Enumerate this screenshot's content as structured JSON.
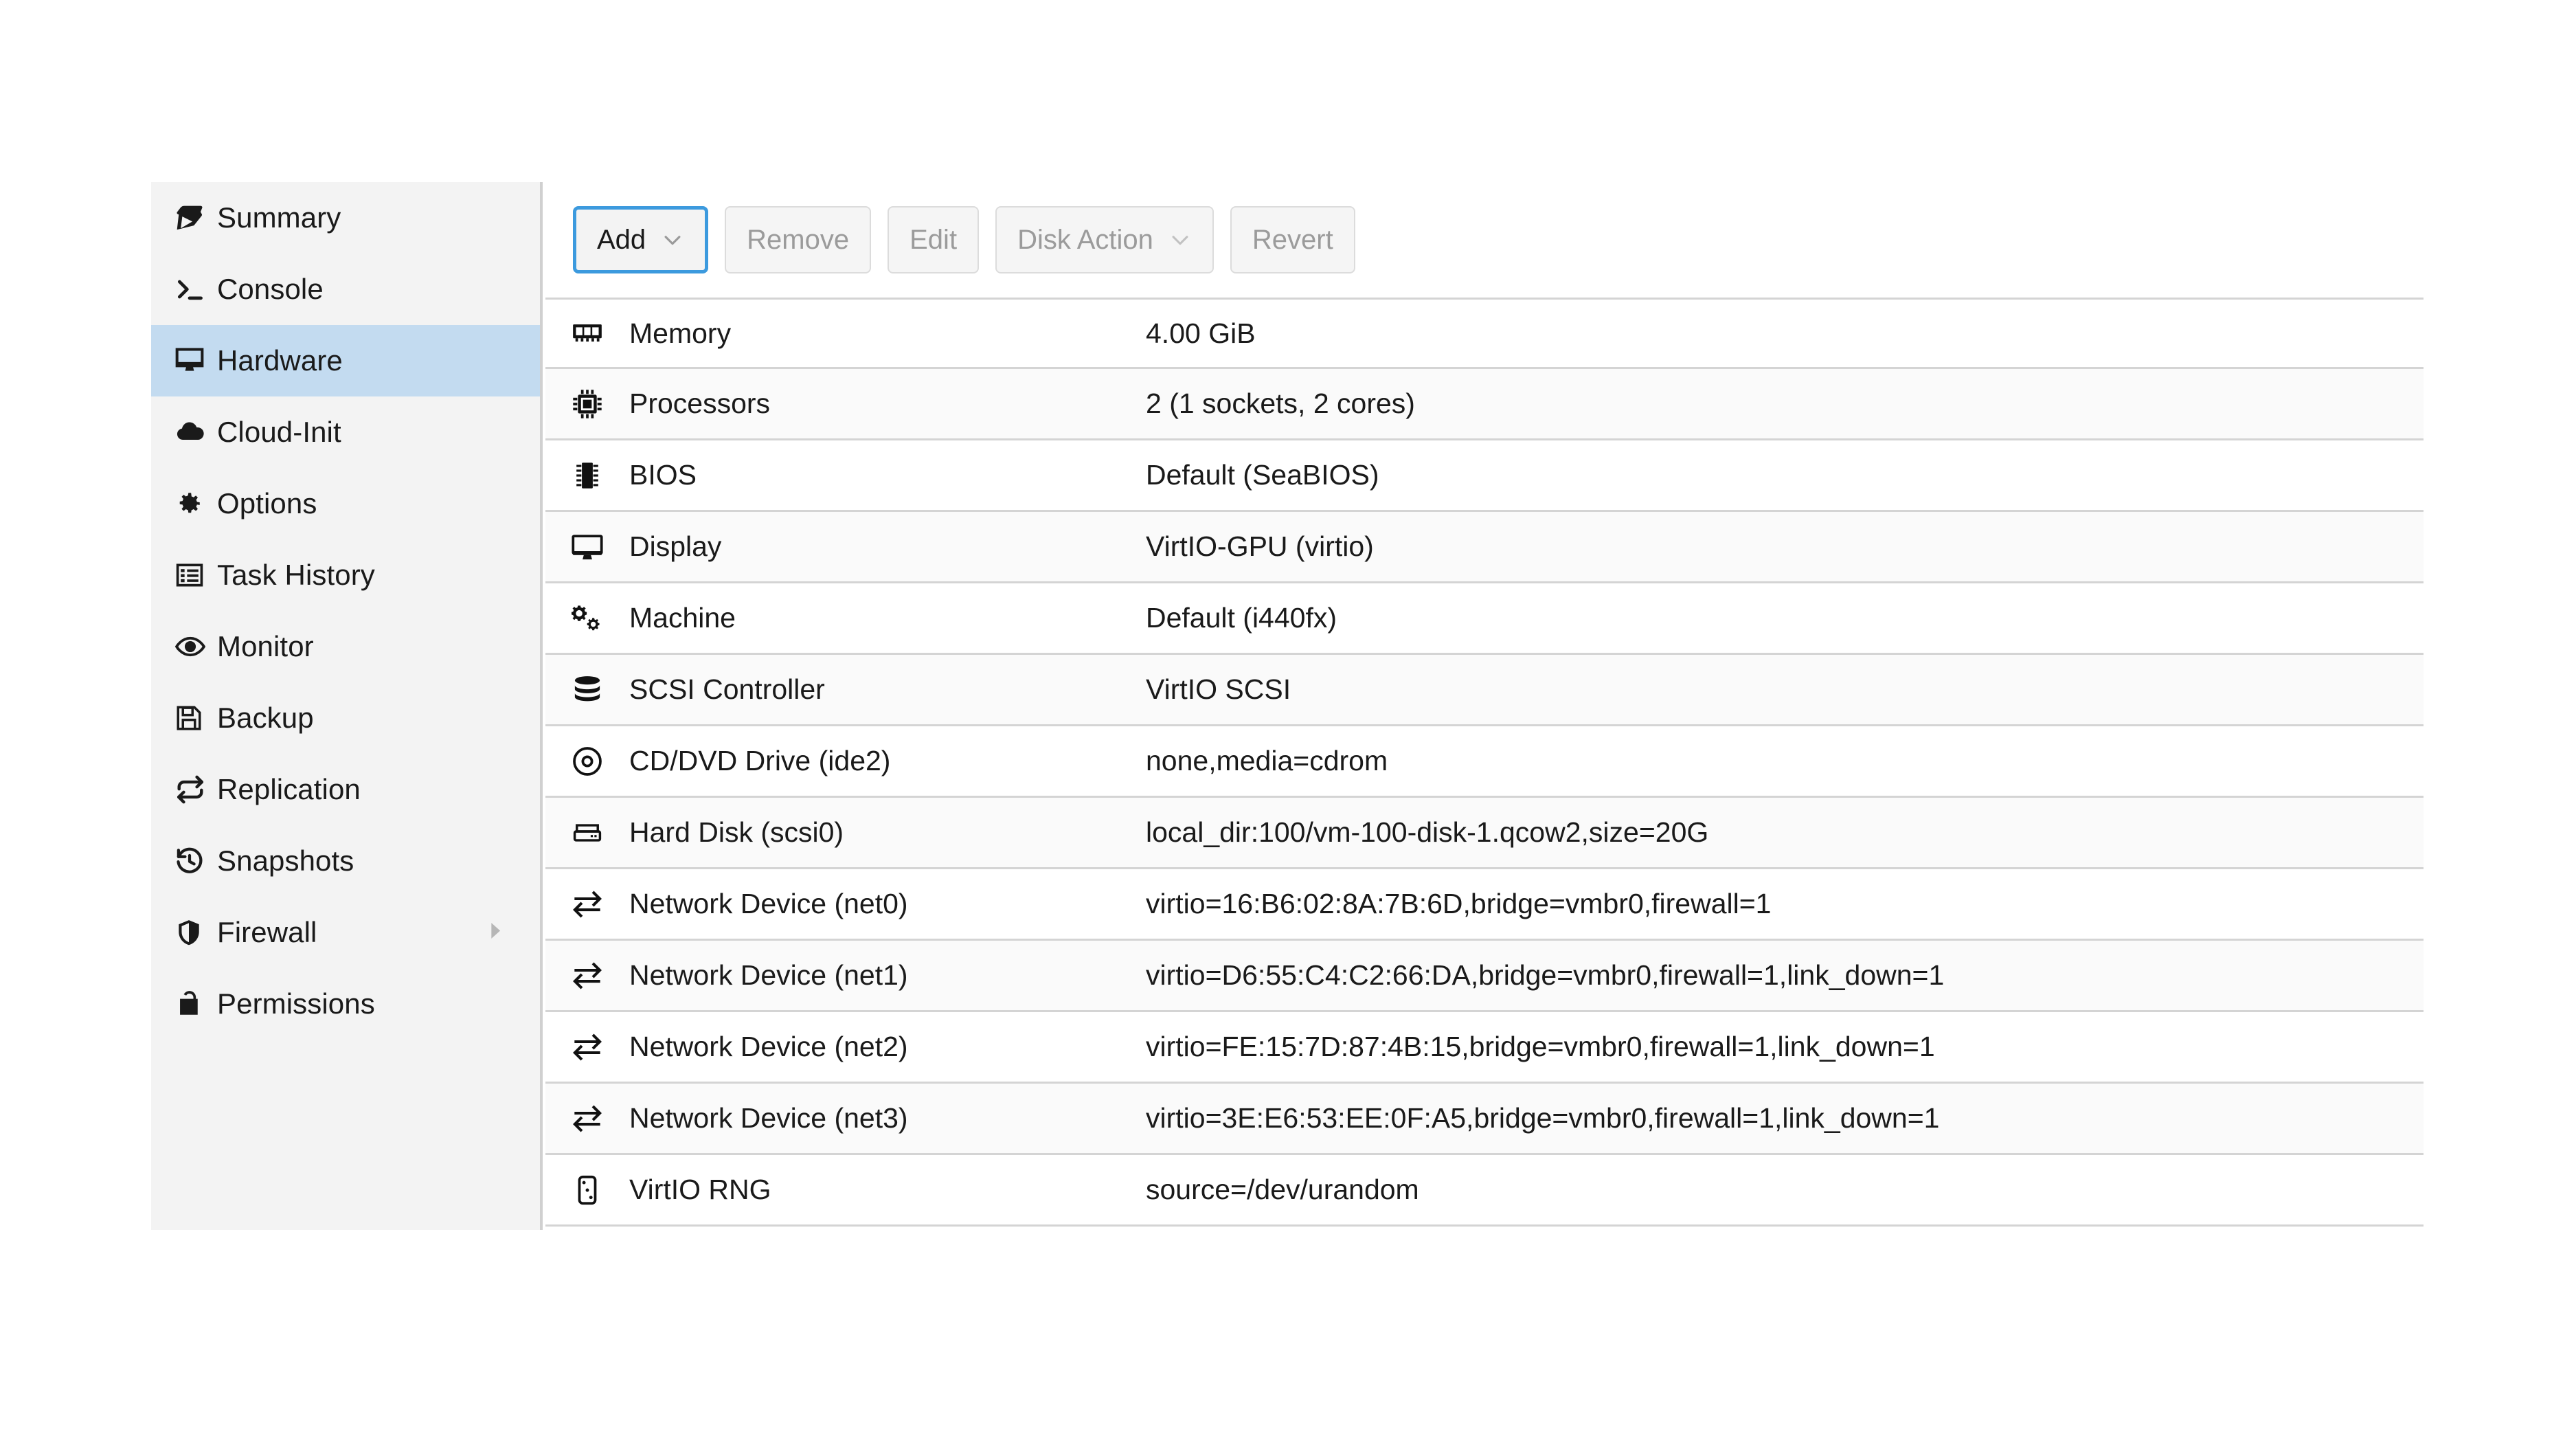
{
  "sidebar": {
    "items": [
      {
        "label": "Summary",
        "icon": "book-icon",
        "selected": false,
        "submenu": false
      },
      {
        "label": "Console",
        "icon": "terminal-icon",
        "selected": false,
        "submenu": false
      },
      {
        "label": "Hardware",
        "icon": "monitor-icon",
        "selected": true,
        "submenu": false
      },
      {
        "label": "Cloud-Init",
        "icon": "cloud-icon",
        "selected": false,
        "submenu": false
      },
      {
        "label": "Options",
        "icon": "gear-icon",
        "selected": false,
        "submenu": false
      },
      {
        "label": "Task History",
        "icon": "list-icon",
        "selected": false,
        "submenu": false
      },
      {
        "label": "Monitor",
        "icon": "eye-icon",
        "selected": false,
        "submenu": false
      },
      {
        "label": "Backup",
        "icon": "floppy-disk-icon",
        "selected": false,
        "submenu": false
      },
      {
        "label": "Replication",
        "icon": "repeat-icon",
        "selected": false,
        "submenu": false
      },
      {
        "label": "Snapshots",
        "icon": "history-icon",
        "selected": false,
        "submenu": false
      },
      {
        "label": "Firewall",
        "icon": "shield-icon",
        "selected": false,
        "submenu": true
      },
      {
        "label": "Permissions",
        "icon": "unlock-icon",
        "selected": false,
        "submenu": false
      }
    ],
    "selected_highlight_color": "#c3dbf0",
    "background_color": "#f3f3f3"
  },
  "toolbar": {
    "focus_color": "#3c9ade",
    "buttons": [
      {
        "label": "Add",
        "enabled": true,
        "has_menu": true
      },
      {
        "label": "Remove",
        "enabled": false,
        "has_menu": false
      },
      {
        "label": "Edit",
        "enabled": false,
        "has_menu": false
      },
      {
        "label": "Disk Action",
        "enabled": false,
        "has_menu": true
      },
      {
        "label": "Revert",
        "enabled": false,
        "has_menu": false
      }
    ]
  },
  "hardware_table": {
    "rows": [
      {
        "icon": "memory-module-icon",
        "name": "Memory",
        "value": "4.00 GiB"
      },
      {
        "icon": "cpu-chip-icon",
        "name": "Processors",
        "value": "2 (1 sockets, 2 cores)"
      },
      {
        "icon": "bios-chip-icon",
        "name": "BIOS",
        "value": "Default (SeaBIOS)"
      },
      {
        "icon": "monitor-icon",
        "name": "Display",
        "value": "VirtIO-GPU (virtio)"
      },
      {
        "icon": "gears-icon",
        "name": "Machine",
        "value": "Default (i440fx)"
      },
      {
        "icon": "database-icon",
        "name": "SCSI Controller",
        "value": "VirtIO SCSI"
      },
      {
        "icon": "optical-disc-icon",
        "name": "CD/DVD Drive (ide2)",
        "value": "none,media=cdrom"
      },
      {
        "icon": "hard-disk-icon",
        "name": "Hard Disk (scsi0)",
        "value": "local_dir:100/vm-100-disk-1.qcow2,size=20G"
      },
      {
        "icon": "exchange-icon",
        "name": "Network Device (net0)",
        "value": "virtio=16:B6:02:8A:7B:6D,bridge=vmbr0,firewall=1"
      },
      {
        "icon": "exchange-icon",
        "name": "Network Device (net1)",
        "value": "virtio=D6:55:C4:C2:66:DA,bridge=vmbr0,firewall=1,link_down=1"
      },
      {
        "icon": "exchange-icon",
        "name": "Network Device (net2)",
        "value": "virtio=FE:15:7D:87:4B:15,bridge=vmbr0,firewall=1,link_down=1"
      },
      {
        "icon": "exchange-icon",
        "name": "Network Device (net3)",
        "value": "virtio=3E:E6:53:EE:0F:A5,bridge=vmbr0,firewall=1,link_down=1"
      },
      {
        "icon": "rng-dice-icon",
        "name": "VirtIO RNG",
        "value": "source=/dev/urandom"
      }
    ]
  }
}
